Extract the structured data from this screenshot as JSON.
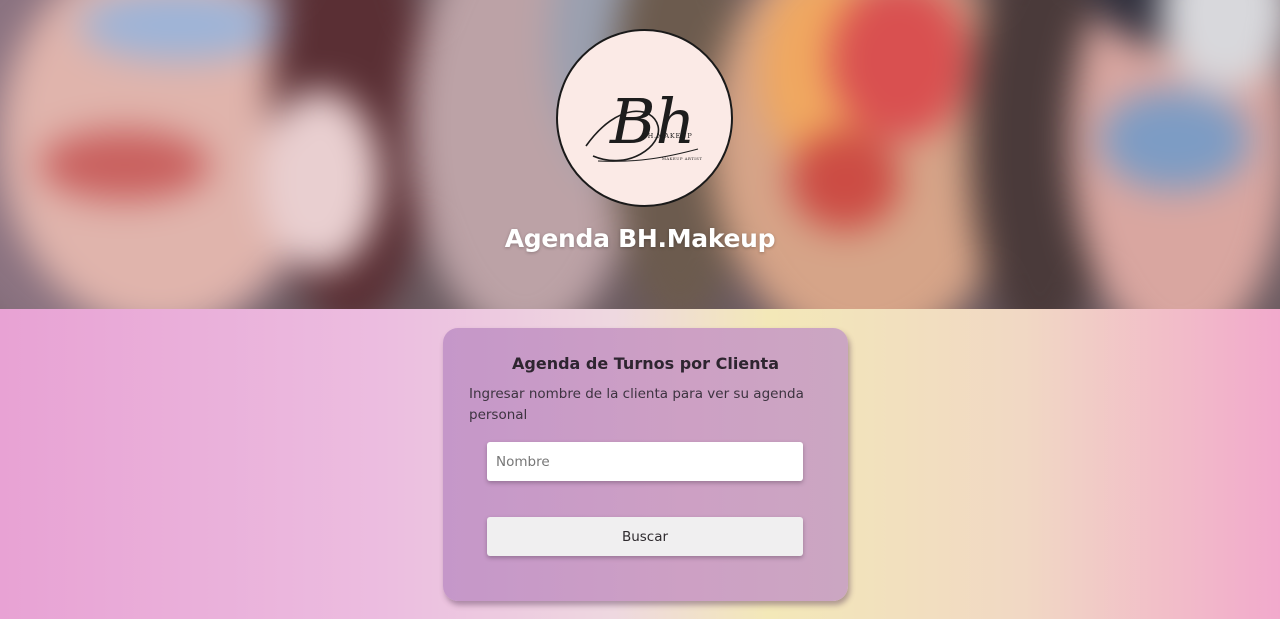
{
  "hero": {
    "title": "Agenda BH.Makeup"
  },
  "logo": {
    "monogram": "Bh",
    "brand": "BH.MAKEUP",
    "tagline": "MAKEUP ARTIST"
  },
  "search_card": {
    "title": "Agenda de Turnos por Clienta",
    "description": "Ingresar nombre de la clienta para ver su agenda personal",
    "name_input": {
      "placeholder": "Nombre",
      "value": ""
    },
    "search_button_label": "Buscar"
  },
  "colors": {
    "page_gradient": [
      "#e8a2d4",
      "#f3e8b8",
      "#f2a9cc"
    ],
    "card_background": "#c597c9",
    "logo_background": "#fbeae6"
  }
}
